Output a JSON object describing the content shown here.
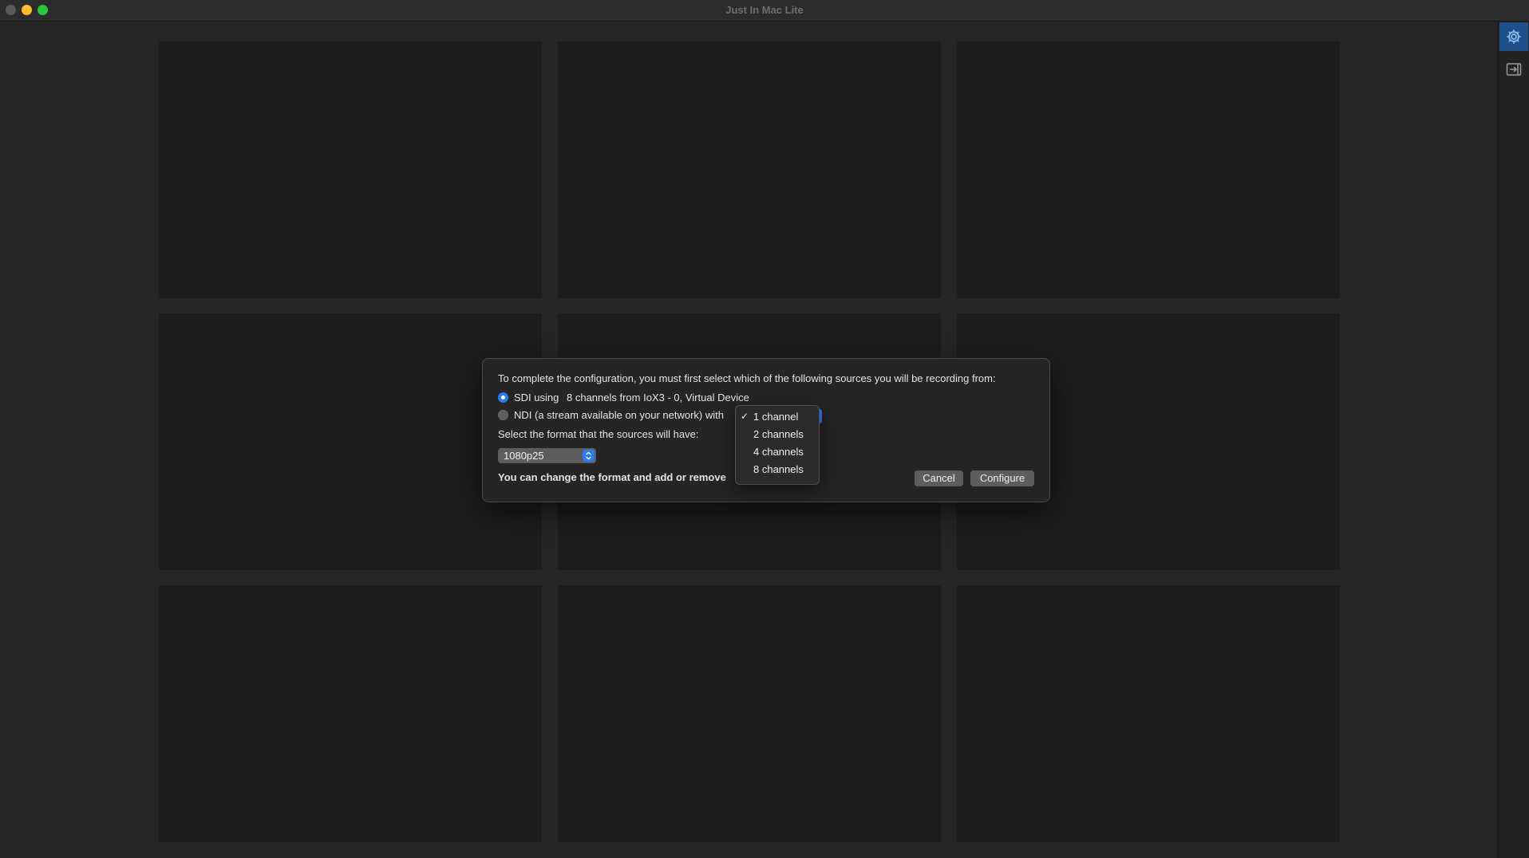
{
  "window": {
    "title": "Just In Mac Lite"
  },
  "toolbar": {
    "settings_icon": "gear-icon",
    "export_icon": "panel-export-icon",
    "accent": "#2a7cf0"
  },
  "dialog": {
    "intro": "To complete the configuration, you must first select which of the following sources you will be recording from:",
    "sdi_label": "SDI using",
    "sdi_detail": "8 channels from IoX3 - 0, Virtual Device",
    "ndi_label": "NDI (a stream available on your network) with",
    "format_prompt": "Select the format that the sources will have:",
    "format_value": "1080p25",
    "note": "You can change the format and add or remove",
    "cancel_label": "Cancel",
    "configure_label": "Configure"
  },
  "channels_menu": {
    "selected": "1 channel",
    "options": [
      "1 channel",
      "2 channels",
      "4 channels",
      "8 channels"
    ]
  }
}
